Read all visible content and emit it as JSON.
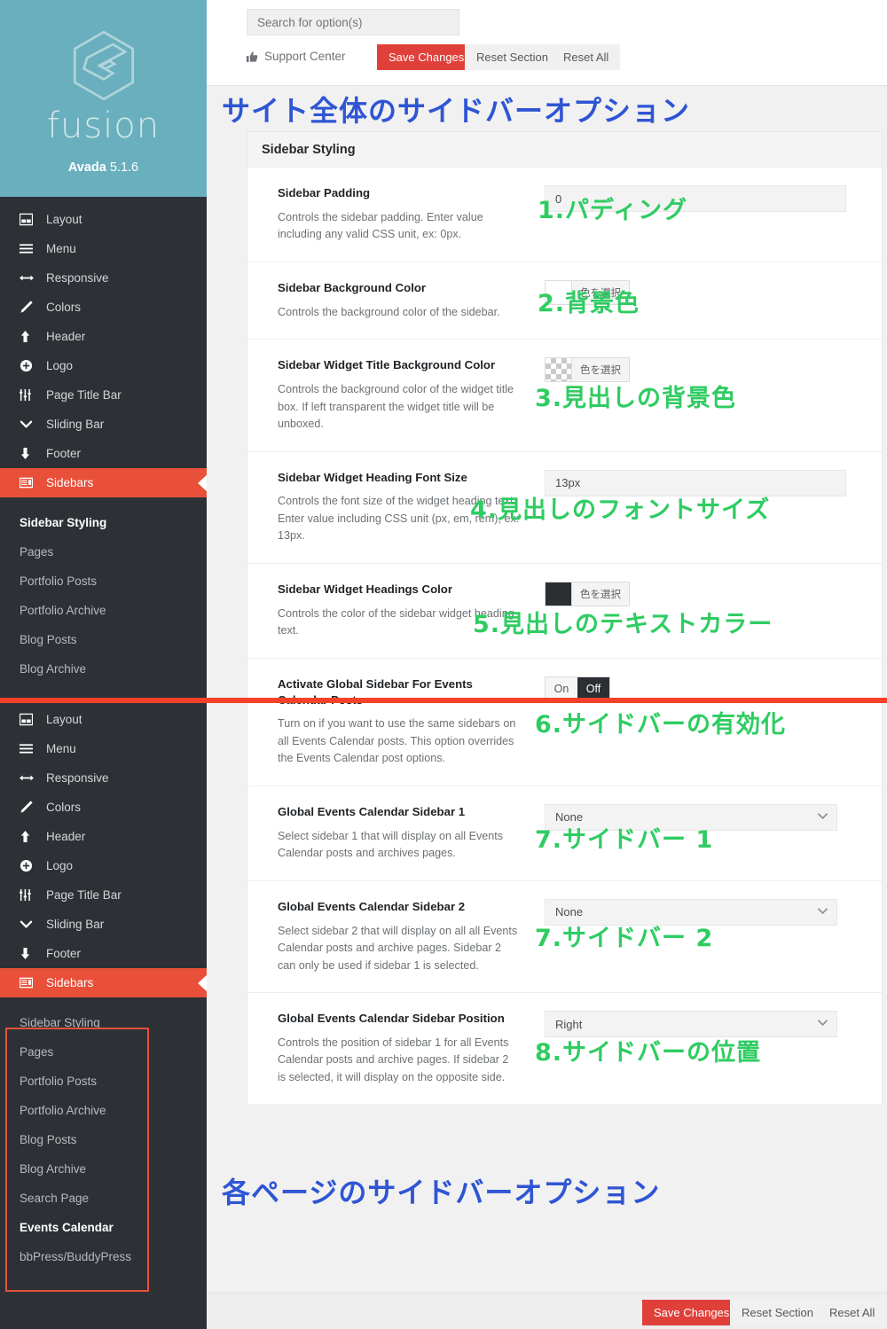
{
  "brand": {
    "logo_icon": "fusion-hexagon-logo",
    "wordmark": "fusion",
    "product": "Avada",
    "version": "5.1.6"
  },
  "colors": {
    "brand_teal": "#6aafbd",
    "nav_dark": "#2d3136",
    "accent_red": "#e8503a",
    "button_red": "#e0403a",
    "seam_red": "#f6412a",
    "anno_blue": "#2f55d4",
    "anno_green": "#2fcc62"
  },
  "nav": {
    "items": [
      {
        "label": "Layout",
        "icon": "layout-icon",
        "active": false
      },
      {
        "label": "Menu",
        "icon": "menu-bars-icon",
        "active": false
      },
      {
        "label": "Responsive",
        "icon": "arrows-h-icon",
        "active": false
      },
      {
        "label": "Colors",
        "icon": "paintbrush-icon",
        "active": false
      },
      {
        "label": "Header",
        "icon": "arrow-up-icon",
        "active": false
      },
      {
        "label": "Logo",
        "icon": "plus-circle-icon",
        "active": false
      },
      {
        "label": "Page Title Bar",
        "icon": "sliders-icon",
        "active": false
      },
      {
        "label": "Sliding Bar",
        "icon": "chevron-down-icon",
        "active": false
      },
      {
        "label": "Footer",
        "icon": "arrow-down-icon",
        "active": false
      },
      {
        "label": "Sidebars",
        "icon": "sidebar-icon",
        "active": true
      }
    ],
    "sub_items_top": [
      {
        "label": "Sidebar Styling",
        "current": true
      },
      {
        "label": "Pages",
        "current": false
      },
      {
        "label": "Portfolio Posts",
        "current": false
      },
      {
        "label": "Portfolio Archive",
        "current": false
      },
      {
        "label": "Blog Posts",
        "current": false
      },
      {
        "label": "Blog Archive",
        "current": false
      }
    ],
    "sub_items_bottom": [
      {
        "label": "Sidebar Styling",
        "current": false
      },
      {
        "label": "Pages",
        "current": false
      },
      {
        "label": "Portfolio Posts",
        "current": false
      },
      {
        "label": "Portfolio Archive",
        "current": false
      },
      {
        "label": "Blog Posts",
        "current": false
      },
      {
        "label": "Blog Archive",
        "current": false
      },
      {
        "label": "Search Page",
        "current": false
      },
      {
        "label": "Events Calendar",
        "current": true
      },
      {
        "label": "bbPress/BuddyPress",
        "current": false
      }
    ]
  },
  "toolbar": {
    "search_placeholder": "Search for option(s)",
    "search_value": "",
    "support_label": "Support Center",
    "support_icon": "thumbs-up-icon",
    "save_label": "Save Changes",
    "reset_section_label": "Reset Section",
    "reset_all_label": "Reset All"
  },
  "annotations": {
    "top_blue": "サイト全体のサイドバーオプション",
    "bottom_blue": "各ページのサイドバーオプション",
    "green": [
      "1.パディング",
      "2.背景色",
      "3.見出しの背景色",
      "4.見出しのフォントサイズ",
      "5.見出しのテキストカラー",
      "6.サイドバーの有効化",
      "7.サイドバー 1",
      "7.サイドバー 2",
      "8.サイドバーの位置"
    ]
  },
  "panel": {
    "section_title": "Sidebar Styling",
    "options": [
      {
        "title": "Sidebar Padding",
        "desc": "Controls the sidebar padding. Enter value including any valid CSS unit, ex: 0px.",
        "control": "text",
        "value": "0"
      },
      {
        "title": "Sidebar Background Color",
        "desc": "Controls the background color of the sidebar.",
        "control": "color",
        "swatch": "white",
        "button_label": "色を選択"
      },
      {
        "title": "Sidebar Widget Title Background Color",
        "desc": "Controls the background color of the widget title box. If left transparent the widget title will be unboxed.",
        "control": "color",
        "swatch": "transparent",
        "button_label": "色を選択"
      },
      {
        "title": "Sidebar Widget Heading Font Size",
        "desc": "Controls the font size of the widget heading text. Enter value including CSS unit (px, em, rem), ex: 13px.",
        "control": "text",
        "value": "13px"
      },
      {
        "title": "Sidebar Widget Headings Color",
        "desc": "Controls the color of the sidebar widget heading text.",
        "control": "color",
        "swatch": "dark",
        "button_label": "色を選択"
      },
      {
        "title": "Activate Global Sidebar For Events Calendar Posts",
        "desc": "Turn on if you want to use the same sidebars on all Events Calendar posts. This option overrides the Events Calendar post options.",
        "control": "toggle",
        "on_label": "On",
        "off_label": "Off",
        "selected": "Off"
      },
      {
        "title": "Global Events Calendar Sidebar 1",
        "desc": "Select sidebar 1 that will display on all Events Calendar posts and archives pages.",
        "control": "select",
        "value": "None"
      },
      {
        "title": "Global Events Calendar Sidebar 2",
        "desc": "Select sidebar 2 that will display on all all Events Calendar posts and archive pages. Sidebar 2 can only be used if sidebar 1 is selected.",
        "control": "select",
        "value": "None"
      },
      {
        "title": "Global Events Calendar Sidebar Position",
        "desc": "Controls the position of sidebar 1 for all Events Calendar posts and archive pages. If sidebar 2 is selected, it will display on the opposite side.",
        "control": "select",
        "value": "Right"
      }
    ]
  }
}
